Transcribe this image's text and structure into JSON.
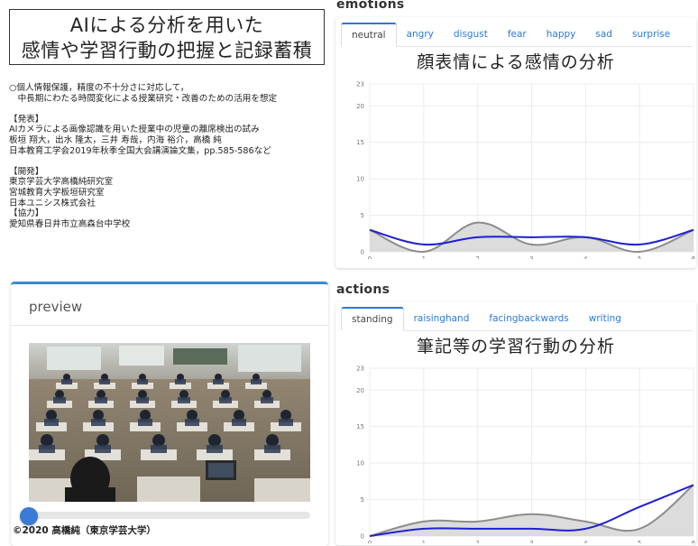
{
  "title": {
    "line1": "AIによる分析を用いた",
    "line2": "感情や学習行動の把握と記録蓄積"
  },
  "description": {
    "intro": [
      "○個人情報保護，精度の不十分さに対応して，",
      "　中長期にわたる時間変化による授業研究・改善のための活用を想定"
    ],
    "presentation_heading": "【発表】",
    "presentation": [
      "AIカメラによる画像認識を用いた授業中の児童の離席検出の試み",
      "板垣 翔大，出水 隆太，三井 寿哉，内海 裕介，高橋 純",
      "日本教育工学会2019年秋季全国大会講演論文集，pp.585-586など"
    ],
    "development_heading": "【開発】",
    "development": [
      "東京学芸大学高橋純研究室",
      "宮城教育大学板垣研究室",
      "日本ユニシス株式会社"
    ],
    "cooperation_heading": "【協力】",
    "cooperation": [
      "愛知県春日井市立高森台中学校"
    ]
  },
  "preview": {
    "title": "preview",
    "slider_value": 0,
    "copyright": "©2020 高橋純（東京学芸大学）"
  },
  "emotions": {
    "section_title": "emotions",
    "tabs": [
      "neutral",
      "angry",
      "disgust",
      "fear",
      "happy",
      "sad",
      "surprise"
    ],
    "active_tab": 0,
    "chart_title": "顔表情による感情の分析"
  },
  "actions": {
    "section_title": "actions",
    "tabs": [
      "standing",
      "raisinghand",
      "facingbackwards",
      "writing"
    ],
    "active_tab": 0,
    "chart_title": "筆記等の学習行動の分析"
  },
  "colors": {
    "series_gray": "#8c8c8c",
    "series_blue": "#1f1fd6",
    "area_fill": "#d6d6d6",
    "tab_accent": "#2a7ad4"
  },
  "chart_data": [
    {
      "type": "line",
      "panel": "emotions",
      "title": "顔表情による感情の分析",
      "x": [
        0,
        1,
        2,
        3,
        4,
        5,
        6
      ],
      "xlim": [
        0,
        6
      ],
      "ylim": [
        0,
        23
      ],
      "y_ticks": [
        0,
        5,
        10,
        15,
        20,
        23
      ],
      "grid": true,
      "series": [
        {
          "style": "gray-area",
          "values": [
            3,
            0,
            4,
            1,
            2,
            0,
            3
          ]
        },
        {
          "style": "blue-line",
          "values": [
            3,
            1,
            2,
            2,
            2,
            1,
            3
          ]
        }
      ]
    },
    {
      "type": "line",
      "panel": "actions",
      "title": "筆記等の学習行動の分析",
      "x": [
        0,
        1,
        2,
        3,
        4,
        5,
        6
      ],
      "xlim": [
        0,
        6
      ],
      "ylim": [
        0,
        23
      ],
      "y_ticks": [
        0,
        5,
        10,
        15,
        20,
        23
      ],
      "grid": true,
      "series": [
        {
          "style": "gray-area",
          "values": [
            0,
            2,
            2,
            3,
            2,
            1,
            7
          ]
        },
        {
          "style": "blue-line",
          "values": [
            0,
            1,
            1,
            1,
            1,
            4,
            7
          ]
        }
      ]
    }
  ]
}
